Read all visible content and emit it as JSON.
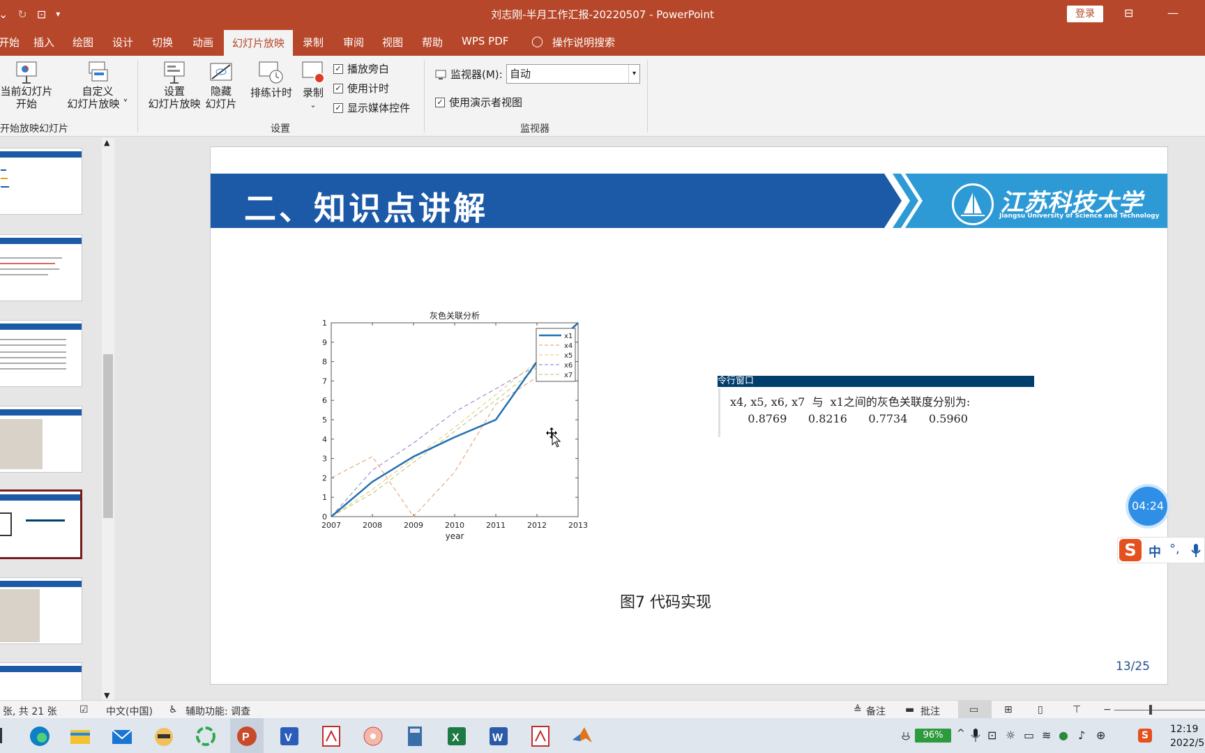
{
  "window": {
    "title": "刘志刚-半月工作汇报-20220507  -  PowerPoint",
    "login": "登录"
  },
  "tabs": [
    {
      "label": "开始"
    },
    {
      "label": "插入"
    },
    {
      "label": "绘图"
    },
    {
      "label": "设计"
    },
    {
      "label": "切换"
    },
    {
      "label": "动画"
    },
    {
      "label": "幻灯片放映"
    },
    {
      "label": "录制"
    },
    {
      "label": "审阅"
    },
    {
      "label": "视图"
    },
    {
      "label": "帮助"
    },
    {
      "label": "WPS PDF"
    },
    {
      "label": "操作说明搜索"
    }
  ],
  "ribbon": {
    "from_current_l1": "当前幻灯片",
    "from_current_l2": "开始",
    "custom_l1": "自定义",
    "custom_l2": "幻灯片放映 ˅",
    "group_start": "开始放映幻灯片",
    "setup_l1": "设置",
    "setup_l2": "幻灯片放映",
    "hide_l1": "隐藏",
    "hide_l2": "幻灯片",
    "rehearse": "排练计时",
    "record": "录制",
    "cb_narration": "播放旁白",
    "cb_timing": "使用计时",
    "cb_media": "显示媒体控件",
    "group_setup": "设置",
    "monitor_label": "监视器(M):",
    "monitor_value": "自动",
    "cb_presenter": "使用演示者视图",
    "group_monitor": "监视器"
  },
  "slide": {
    "title": "二、知识点讲解",
    "logo_text": "江苏科技大学",
    "logo_sub": "Jiangsu University of Science and Technology",
    "cmd_header": "令行窗口",
    "cmd_line1": "x4, x5, x6, x7  与  x1之间的灰色关联度分别为:",
    "cmd_line2": "     0.8769      0.8216      0.7734      0.5960",
    "caption": "图7 代码实现",
    "page": "13/25"
  },
  "timer": "04:24",
  "ime": {
    "cn": "中",
    "punct": "°,"
  },
  "status": {
    "slide_count": "张, 共 21 张",
    "language": "中文(中国)",
    "accessibility": "辅助功能: 调查",
    "notes": "备注",
    "comments": "批注"
  },
  "taskbar": {
    "battery": "96%",
    "time": "12:19",
    "date": "2022/5"
  },
  "colors": {
    "accent": "#b7472a",
    "slide_blue": "#1c5aa8",
    "banner_light": "#2d9ad6",
    "page_num": "#1f4e8c"
  },
  "chart_data": {
    "type": "line",
    "title": "灰色关联分析",
    "xlabel": "year",
    "ylabel": "",
    "x": [
      2007,
      2008,
      2009,
      2010,
      2011,
      2012,
      2013
    ],
    "xlim": [
      2007,
      2013
    ],
    "ylim": [
      0,
      1
    ],
    "yticks": [
      0,
      0.1,
      0.2,
      0.3,
      0.4,
      0.5,
      0.6,
      0.7,
      0.8,
      0.9,
      1
    ],
    "legend_position": "top-right",
    "series": [
      {
        "name": "x1",
        "color": "#1f6fb2",
        "dash": false,
        "values": [
          0,
          0.18,
          0.31,
          0.41,
          0.5,
          0.8,
          1
        ]
      },
      {
        "name": "x4",
        "color": "#e09a6a",
        "dash": true,
        "values": [
          0.2,
          0.31,
          0,
          0.23,
          0.58,
          0.72,
          1
        ]
      },
      {
        "name": "x5",
        "color": "#e8c66a",
        "dash": true,
        "values": [
          0,
          0.14,
          0.3,
          0.46,
          0.63,
          0.8,
          1
        ]
      },
      {
        "name": "x6",
        "color": "#8a78c8",
        "dash": true,
        "values": [
          0,
          0.24,
          0.38,
          0.54,
          0.66,
          0.78,
          1
        ]
      },
      {
        "name": "x7",
        "color": "#b0c070",
        "dash": true,
        "values": [
          0,
          0.12,
          0.28,
          0.44,
          0.6,
          0.77,
          1
        ]
      }
    ]
  }
}
